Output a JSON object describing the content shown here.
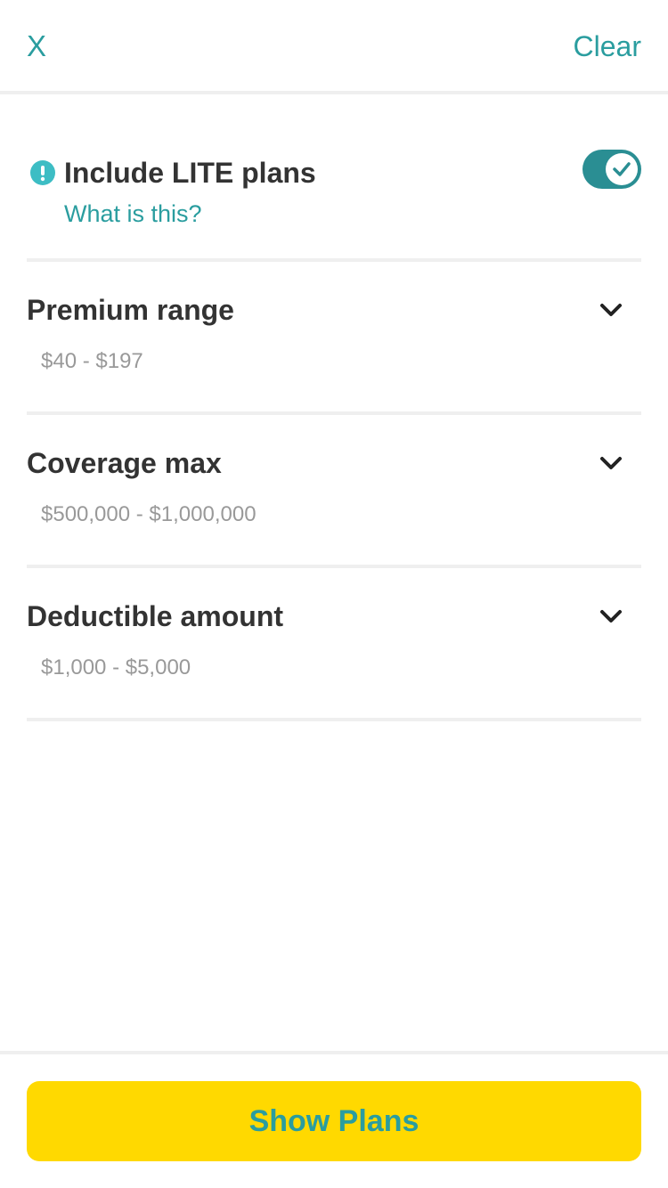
{
  "header": {
    "close_label": "X",
    "clear_label": "Clear"
  },
  "lite": {
    "title": "Include LITE plans",
    "link": "What is this?",
    "toggle_on": true,
    "info_icon": "exclamation-circle-icon",
    "accent_color": "#2a9d9f"
  },
  "filters": [
    {
      "title": "Premium range",
      "value": "$40 - $197"
    },
    {
      "title": "Coverage max",
      "value": "$500,000 - $1,000,000"
    },
    {
      "title": "Deductible amount",
      "value": "$1,000 - $5,000"
    }
  ],
  "footer": {
    "button_label": "Show Plans",
    "button_color": "#ffd900"
  }
}
